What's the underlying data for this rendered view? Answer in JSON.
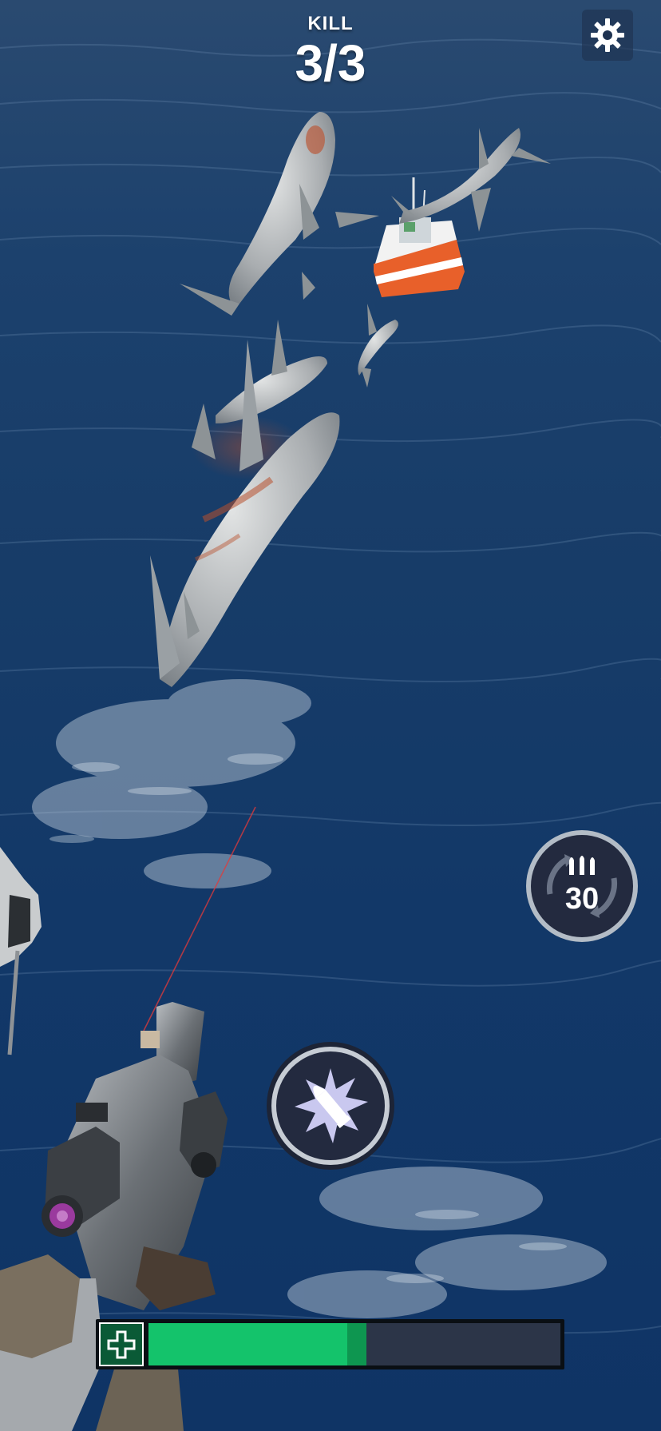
{
  "hud": {
    "kill_label": "KILL",
    "kill_count": "3/3"
  },
  "controls": {
    "settings_icon": "gear-icon",
    "reload_ammo": "30",
    "reload_icon": "reload-bullets-icon",
    "fire_icon": "bullet-burst-icon"
  },
  "health": {
    "icon": "plus-icon",
    "level": 0.53
  },
  "colors": {
    "ocean": "#173c68",
    "health_fill": "#14c36b",
    "health_track": "#2c3548",
    "health_icon_bg": "#0a5a36",
    "button_fill": "#232a3f",
    "boat_hull": "#e8602a"
  }
}
